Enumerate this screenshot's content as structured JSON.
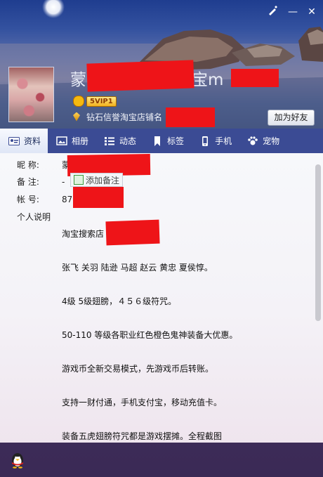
{
  "window": {
    "skin_label": "skin",
    "minimize_label": "—",
    "close_label": "✕"
  },
  "profile": {
    "nickname_visible": "蒙",
    "nickname_tail": "宝m",
    "vip_label": "5VIP1",
    "shop_text": "钻石信誉淘宝店铺名",
    "add_friend": "加为好友"
  },
  "tabs": [
    {
      "label": "资料",
      "icon": "id-card-icon",
      "active": true
    },
    {
      "label": "相册",
      "icon": "photo-icon"
    },
    {
      "label": "动态",
      "icon": "feed-icon"
    },
    {
      "label": "标签",
      "icon": "bookmark-icon"
    },
    {
      "label": "手机",
      "icon": "phone-icon"
    },
    {
      "label": "宠物",
      "icon": "paw-icon"
    }
  ],
  "info": {
    "nickname_label": "昵    称:",
    "nickname_value": "蒙",
    "remark_label": "备    注:",
    "remark_value": "-",
    "add_remark": "添加备注",
    "account_label": "帐    号:",
    "account_value": "87",
    "bio_label": "个人说明"
  },
  "bio": [
    "淘宝搜索店",
    "张飞 关羽 陆逊 马超 赵云 黄忠 夏侯惇。",
    "4级 5级翅膀，４５６级符咒。",
    "50-110 等级各职业红色橙色鬼神装备大优惠。",
    "游戏币全新交易模式，先游戏币后转账。",
    "支持一财付通，手机支付宝，移动充值卡。",
    "装备五虎翅膀符咒都是游戏摆摊。全程截图"
  ],
  "colors": {
    "tabbar": "#3b4b94",
    "footer": "#3a2a55",
    "redaction": "#ee1418"
  }
}
